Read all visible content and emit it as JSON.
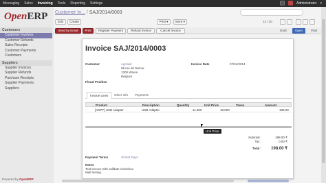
{
  "topbar": {
    "nav": [
      "Messaging",
      "Sales",
      "Invoicing",
      "Tools",
      "Reporting",
      "Settings"
    ],
    "active": "Invoicing",
    "user": "Administrator"
  },
  "logo": {
    "open": "Open",
    "erp": "ERP"
  },
  "sidebar": {
    "sections": [
      {
        "header": "Customers",
        "items": [
          "Customer Invoices",
          "Customer Refunds",
          "Sales Receipts",
          "Customer Payments",
          "Customers"
        ]
      },
      {
        "header": "Suppliers",
        "items": [
          "Supplier Invoices",
          "Supplier Refunds",
          "Purchase Receipts",
          "Supplier Payments",
          "Suppliers"
        ]
      }
    ],
    "selected": "Customer Invoices",
    "powered_prefix": "Powered by ",
    "powered_brand": "OpenERP"
  },
  "breadcrumb": {
    "crumb": "Customer In...",
    "sep": " / ",
    "current": "SAJ/2014/0003"
  },
  "toolbar": {
    "edit": "Edit",
    "create": "Create",
    "print": "Print ▾",
    "more": "More ▾",
    "pager": "12 / 20"
  },
  "actions": [
    "Send by Email",
    "Print",
    "Register Payment",
    "Refund Invoice",
    "Cancel Invoice"
  ],
  "statuses": [
    "Draft",
    "Open",
    "Paid"
  ],
  "active_status": "Open",
  "invoice": {
    "title": "Invoice SAJ/2014/0003",
    "customer_label": "Customer",
    "customer_name": "Agrolait",
    "address": [
      "69 rue de Namur",
      "1300 Wavre",
      "Belgium"
    ],
    "date_label": "Invoice Date",
    "date_value": "07/24/2014",
    "fiscal_label": "Fiscal Position"
  },
  "tabs": [
    "Invoice Lines",
    "Other Info",
    "Payments"
  ],
  "table": {
    "headers": [
      "Product",
      "Description",
      "Quantity",
      "Unit Price",
      "Taxes",
      "Amount"
    ],
    "rows": [
      [
        "[ADPT] USB Adapter",
        "USB Adapter",
        "11.000",
        "18.000",
        "",
        "198.00"
      ]
    ]
  },
  "tooltip": "Unit Price",
  "totals": {
    "subtotal_label": "Subtotal :",
    "subtotal": "198.00 ₹",
    "tax_label": "Tax :",
    "tax": "0.00 ₹",
    "total_label": "Total :",
    "total": "198.00 ₹"
  },
  "payment_terms_label": "Payment Terms",
  "payment_terms_value": "30 Net Days",
  "notes_label": "Notes",
  "notes": [
    "Test invoice with validate checkbox.",
    "Mail testing."
  ]
}
